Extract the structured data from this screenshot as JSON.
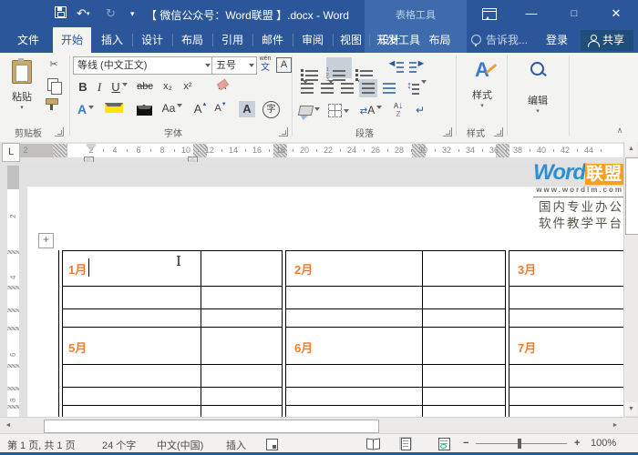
{
  "colors": {
    "accent": "#2b579a",
    "contextual_blue": "#3e6bab",
    "share_bg": "#1e4e79",
    "month_orange": "#ed7d31",
    "logo_blue": "#2e8fd0",
    "logo_orange": "#f6a11d",
    "selected_gray": "#c8d0da"
  },
  "titlebar": {
    "title": "【 微信公众号：Word联盟 】.docx - Word",
    "contextual_label": "表格工具"
  },
  "tabs": {
    "file": "文件",
    "items": [
      "开始",
      "插入",
      "设计",
      "布局",
      "引用",
      "邮件",
      "审阅",
      "视图",
      "开发工具"
    ],
    "active": "开始",
    "contextual": [
      "设计",
      "布局"
    ],
    "tell_me": "告诉我...",
    "sign_in": "登录",
    "share": "共享"
  },
  "ribbon": {
    "clipboard": {
      "label": "剪贴板",
      "paste": "粘贴"
    },
    "font": {
      "label": "字体",
      "name": "等线 (中文正文)",
      "size": "五号",
      "bold": "B",
      "italic": "I",
      "underline": "U",
      "strikethrough": "abc",
      "subscript": "x₂",
      "superscript": "x²",
      "clear_format": "A",
      "text_effects": "A",
      "highlight": "ab",
      "font_color": "A",
      "change_case": "Aa",
      "grow_font": "A",
      "shrink_font": "A",
      "char_shading": "A",
      "enclose": "字",
      "char_border": "A",
      "phonetic_top": "wén",
      "phonetic_bottom": "文"
    },
    "paragraph": {
      "label": "段落",
      "sort_a": "A",
      "sort_z": "Z",
      "scale_a": "A"
    },
    "styles": {
      "label": "样式",
      "button": "样式"
    },
    "editing": {
      "button": "编辑"
    }
  },
  "ruler": {
    "tab_selector": "L",
    "margin_start": "2",
    "numbers": [
      "2",
      "4",
      "6",
      "8",
      "10",
      "12",
      "14",
      "16",
      "18",
      "20",
      "22",
      "24",
      "26",
      "28",
      "30",
      "32",
      "34",
      "36",
      "38",
      "40",
      "42",
      "44"
    ],
    "v_numbers": [
      "2",
      "4",
      "6",
      "8"
    ]
  },
  "document": {
    "watermark": {
      "brand_en": "Word",
      "brand_cn": "联盟",
      "url": "www.wordlm.com",
      "tagline1": "国内专业办公",
      "tagline2": "软件教学平台"
    },
    "table": {
      "row1": [
        "1月",
        "2月",
        "3月"
      ],
      "row2": [
        "5月",
        "6月",
        "7月"
      ]
    }
  },
  "statusbar": {
    "page": "第 1 页, 共 1 页",
    "words": "24 个字",
    "language": "中文(中国)",
    "mode": "插入",
    "zoom_out": "−",
    "zoom_in": "+",
    "zoom": "100%"
  },
  "icons": {
    "undo": "↶",
    "redo": "↻",
    "scissors": "✂",
    "up_small": "▲",
    "down_small": "▼",
    "left_small": "◄",
    "right_small": "►",
    "collapse": "∧",
    "pilcrow": "↵",
    "down_arrow": "↓",
    "updown": "↕",
    "swap": "⇄",
    "move": "+",
    "ibeam": "I",
    "plus": "+"
  }
}
